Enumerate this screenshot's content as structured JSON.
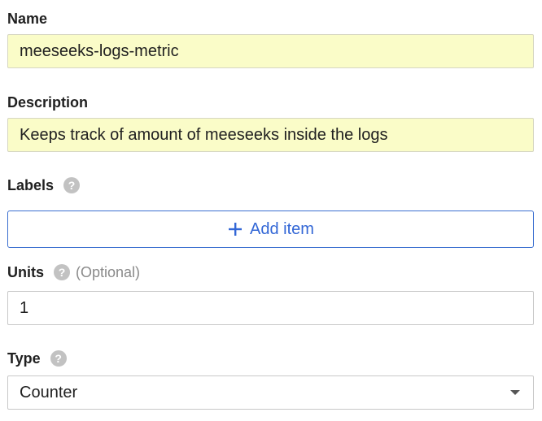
{
  "form": {
    "name": {
      "label": "Name",
      "value": "meeseeks-logs-metric"
    },
    "description": {
      "label": "Description",
      "value": "Keeps track of amount of meeseeks inside the logs"
    },
    "labels": {
      "label": "Labels",
      "help_glyph": "?",
      "add_item_label": "Add item"
    },
    "units": {
      "label": "Units",
      "help_glyph": "?",
      "optional_text": "(Optional)",
      "value": "1"
    },
    "type": {
      "label": "Type",
      "help_glyph": "?",
      "selected": "Counter"
    }
  },
  "colors": {
    "autofill_bg": "#fafcc8",
    "accent_blue": "#3367d6",
    "help_icon": "#c2c2c2",
    "border": "#c8c8c8"
  },
  "icons": {
    "help": "help-circle-icon",
    "add": "plus-icon",
    "dropdown": "caret-down-icon"
  }
}
